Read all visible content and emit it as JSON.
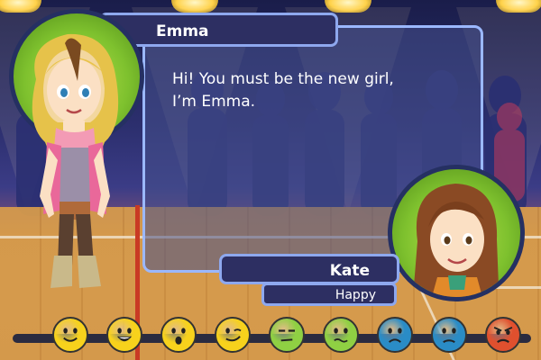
{
  "dialogue": {
    "speaker": "Emma",
    "text": "Hi! You must be the new girl,\nI’m Emma."
  },
  "player": {
    "name": "Kate",
    "mood": "Happy"
  },
  "emotions": [
    {
      "name": "smile-icon",
      "color": "#f7d21c"
    },
    {
      "name": "grin-icon",
      "color": "#f7d21c"
    },
    {
      "name": "surprised-icon",
      "color": "#f7d21c"
    },
    {
      "name": "wink-icon",
      "color": "#f7d21c"
    },
    {
      "name": "unamused-icon",
      "color": "#8fd043"
    },
    {
      "name": "sick-icon",
      "color": "#8fd043"
    },
    {
      "name": "sad-icon",
      "color": "#2a8cc6"
    },
    {
      "name": "worried-icon",
      "color": "#2a8cc6"
    },
    {
      "name": "angry-icon",
      "color": "#e0502e"
    }
  ]
}
